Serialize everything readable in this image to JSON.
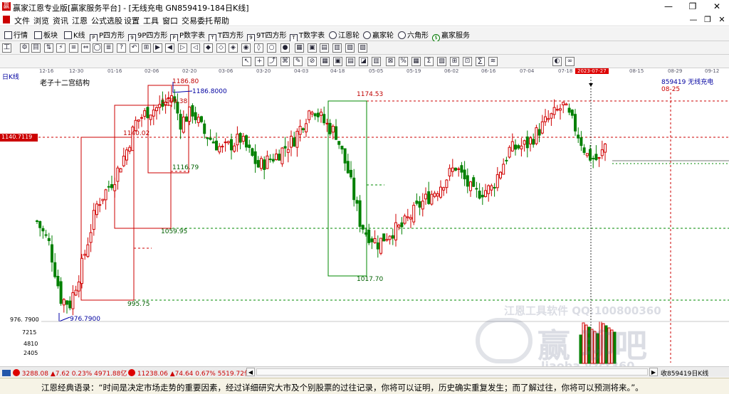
{
  "window": {
    "title": "赢家江恩专业版[赢家服务平台] - [无线充电  GN859419-184日K线]",
    "controls": [
      "—",
      "❐",
      "✕"
    ],
    "mdi_controls": [
      "—",
      "❐",
      "✕"
    ]
  },
  "menu": [
    "文件",
    "浏览",
    "资讯",
    "江恩",
    "公式选股",
    "设置",
    "工具",
    "窗口",
    "交易委托",
    "帮助"
  ],
  "toolbar1": [
    "行情",
    "板块",
    "K线",
    "P四方形",
    "9P四方形",
    "P数字表",
    "T四方形",
    "9T四方形",
    "T数字表",
    "江恩轮",
    "赢家轮",
    "六角形",
    "赢家服务"
  ],
  "toolbar2": [
    "工",
    "⚙",
    "目",
    "⇅",
    "⚡",
    "≡",
    "⇔",
    "◯",
    "≣",
    "?",
    "↶",
    "⊞",
    "▶",
    "◀",
    "▷",
    "◁",
    "◆",
    "◇",
    "◈",
    "◉",
    "◊",
    "○",
    "●",
    "▦",
    "▣",
    "▤",
    "▥",
    "▧",
    "▨"
  ],
  "toolbar3": [
    "↖",
    "+",
    "⤴",
    "⌘",
    "✎",
    "⊘",
    "▦",
    "▣",
    "▤",
    "◪",
    "▥",
    "⊠",
    "%",
    "▦",
    "Σ",
    "▧",
    "⊞",
    "⊡",
    "∑",
    "≋",
    "◐",
    "∞"
  ],
  "date_axis": {
    "labels": [
      "12-16",
      "12-30",
      "01-16",
      "02-06",
      "02-20",
      "03-06",
      "03-20",
      "04-03",
      "04-18",
      "05-05",
      "05-19",
      "06-02",
      "06-16",
      "07-04",
      "07-18",
      "2023-07-27",
      "08-15",
      "08-29",
      "09-12"
    ],
    "selected": "2023-07-27"
  },
  "chart": {
    "period_label": "日K线",
    "indicator_title": "老子十二宫结构",
    "code_name": "859419  无线充电",
    "future_date": "08-25",
    "current_price_tag": "1140.7119",
    "y_min_label": "976.7900",
    "y_min_left": "976. 7900",
    "up_color": "#d00000",
    "down_color": "#008000",
    "price_labels": [
      {
        "text": "1186.80",
        "color": "#c00000"
      },
      {
        "text": "1186.8000",
        "color": "#0000a0"
      },
      {
        "text": "1169.38",
        "color": "#c00000"
      },
      {
        "text": "1140.02",
        "color": "#c00000"
      },
      {
        "text": "1116.79",
        "color": "#006000"
      },
      {
        "text": "1059.95",
        "color": "#006000"
      },
      {
        "text": "995.75",
        "color": "#006000"
      },
      {
        "text": "1174.53",
        "color": "#c00000"
      },
      {
        "text": "1017.70",
        "color": "#006000"
      }
    ],
    "volume_axis": [
      "7215",
      "4810",
      "2405"
    ]
  },
  "watermark": {
    "company": "江恩工具软件  QQ:100800360",
    "brand": "赢  聊吧",
    "site": "liaoba.yzct360"
  },
  "quote_bar": [
    {
      "label": "3288.08",
      "change": "▲7.62",
      "pct": "0.23%",
      "amount": "4971.88亿"
    },
    {
      "label": "11238.06",
      "change": "▲74.64",
      "pct": "0.67%",
      "amount": "5519.72亿"
    }
  ],
  "quote_bar_right": "收859419日K线",
  "status_quote": "江恩经典语录：“时间是决定市场走势的重要因素，经过详细研究大市及个别股票的过往记录，你将可以证明，历史确实重复发生；而了解过往，你将可以预测将来。”。"
}
